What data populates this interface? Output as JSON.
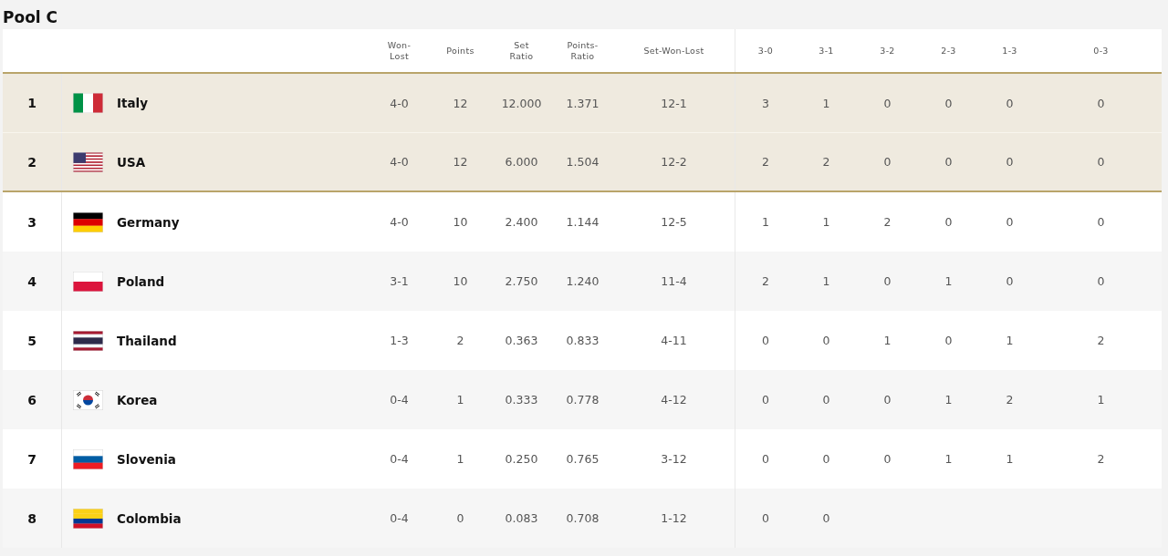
{
  "title": "Pool C",
  "columns": [
    "Won-Lost",
    "Points",
    "Set Ratio",
    "Points-Ratio",
    "Set-Won-Lost",
    "3-0",
    "3-1",
    "3-2",
    "2-3",
    "1-3",
    "0-3"
  ],
  "rows": [
    {
      "rank": "1",
      "team": "Italy",
      "highlighted": true,
      "stats": [
        "4-0",
        "12",
        "12.000",
        "1.371",
        "12-1",
        "3",
        "1",
        "0",
        "0",
        "0",
        "0"
      ]
    },
    {
      "rank": "2",
      "team": "USA",
      "highlighted": true,
      "stats": [
        "4-0",
        "12",
        "6.000",
        "1.504",
        "12-2",
        "2",
        "2",
        "0",
        "0",
        "0",
        "0"
      ]
    },
    {
      "rank": "3",
      "team": "Germany",
      "highlighted": false,
      "stats": [
        "4-0",
        "10",
        "2.400",
        "1.144",
        "12-5",
        "1",
        "1",
        "2",
        "0",
        "0",
        "0"
      ]
    },
    {
      "rank": "4",
      "team": "Poland",
      "highlighted": false,
      "stats": [
        "3-1",
        "10",
        "2.750",
        "1.240",
        "11-4",
        "2",
        "1",
        "0",
        "1",
        "0",
        "0"
      ]
    },
    {
      "rank": "5",
      "team": "Thailand",
      "highlighted": false,
      "stats": [
        "1-3",
        "2",
        "0.363",
        "0.833",
        "4-11",
        "0",
        "0",
        "1",
        "0",
        "1",
        "2"
      ]
    },
    {
      "rank": "6",
      "team": "Korea",
      "highlighted": false,
      "stats": [
        "0-4",
        "1",
        "0.333",
        "0.778",
        "4-12",
        "0",
        "0",
        "0",
        "1",
        "2",
        "1"
      ]
    },
    {
      "rank": "7",
      "team": "Slovenia",
      "highlighted": false,
      "stats": [
        "0-4",
        "1",
        "0.250",
        "0.765",
        "3-12",
        "0",
        "0",
        "0",
        "1",
        "1",
        "2"
      ]
    },
    {
      "rank": "8",
      "team": "Colombia",
      "highlighted": false,
      "stats": [
        "0-4",
        "0",
        "0.083",
        "0.708",
        "1-12",
        "0",
        "0"
      ]
    }
  ]
}
